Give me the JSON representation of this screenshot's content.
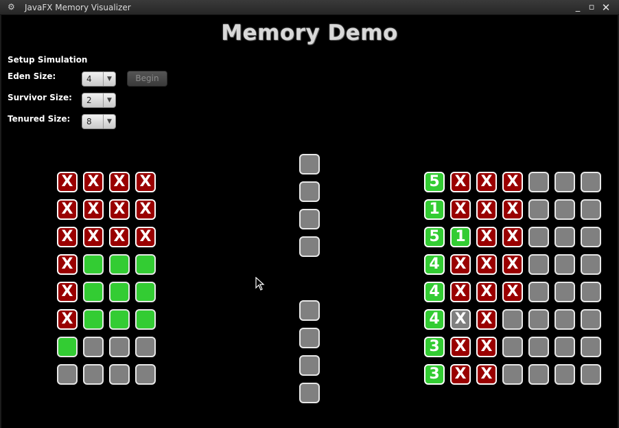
{
  "window": {
    "title": "JavaFX Memory Visualizer",
    "icons": {
      "app": "gear-icon",
      "minimize": "minimize-icon",
      "maximize": "maximize-icon",
      "close": "close-icon"
    }
  },
  "heading": "Memory Demo",
  "setup": {
    "title": "Setup Simulation",
    "eden_label": "Eden Size:",
    "eden_value": "4",
    "survivor_label": "Survivor Size:",
    "survivor_value": "2",
    "tenured_label": "Tenured Size:",
    "tenured_value": "8",
    "begin_label": "Begin"
  },
  "colors": {
    "live": "#33cc33",
    "empty": "#808080",
    "dead": "#990000",
    "background": "#000000"
  },
  "legend_states": {
    "X": "collected object (X mark)",
    "G": "live object",
    "E": "empty slot"
  },
  "eden_grid": [
    [
      "X",
      "X",
      "X",
      "X"
    ],
    [
      "X",
      "X",
      "X",
      "X"
    ],
    [
      "X",
      "X",
      "X",
      "X"
    ],
    [
      "X",
      "G",
      "G",
      "G"
    ],
    [
      "X",
      "G",
      "G",
      "G"
    ],
    [
      "X",
      "G",
      "G",
      "G"
    ],
    [
      "G",
      "E",
      "E",
      "E"
    ],
    [
      "E",
      "E",
      "E",
      "E"
    ]
  ],
  "survivor_slots": [
    "E",
    "E",
    "E",
    "E",
    "E",
    "E",
    "E",
    "E"
  ],
  "tenured_grid": [
    [
      "5",
      "X",
      "X",
      "X",
      "E",
      "E",
      "E"
    ],
    [
      "1",
      "X",
      "X",
      "X",
      "E",
      "E",
      "E"
    ],
    [
      "5",
      "1",
      "X",
      "X",
      "E",
      "E",
      "E"
    ],
    [
      "4",
      "X",
      "X",
      "X",
      "E",
      "E",
      "E"
    ],
    [
      "4",
      "X",
      "X",
      "X",
      "E",
      "E",
      "E"
    ],
    [
      "4",
      "XG",
      "X",
      "E",
      "E",
      "E",
      "E"
    ],
    [
      "3",
      "X",
      "X",
      "E",
      "E",
      "E",
      "E"
    ],
    [
      "3",
      "X",
      "X",
      "E",
      "E",
      "E",
      "E"
    ]
  ]
}
